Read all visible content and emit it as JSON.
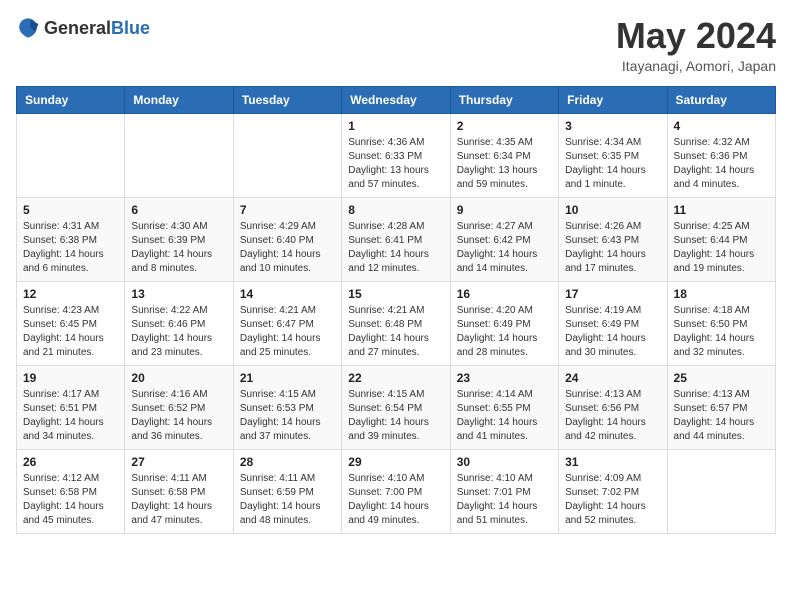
{
  "header": {
    "logo_general": "General",
    "logo_blue": "Blue",
    "month_title": "May 2024",
    "location": "Itayanagi, Aomori, Japan"
  },
  "days_of_week": [
    "Sunday",
    "Monday",
    "Tuesday",
    "Wednesday",
    "Thursday",
    "Friday",
    "Saturday"
  ],
  "weeks": [
    [
      {
        "day": "",
        "info": ""
      },
      {
        "day": "",
        "info": ""
      },
      {
        "day": "",
        "info": ""
      },
      {
        "day": "1",
        "info": "Sunrise: 4:36 AM\nSunset: 6:33 PM\nDaylight: 13 hours and 57 minutes."
      },
      {
        "day": "2",
        "info": "Sunrise: 4:35 AM\nSunset: 6:34 PM\nDaylight: 13 hours and 59 minutes."
      },
      {
        "day": "3",
        "info": "Sunrise: 4:34 AM\nSunset: 6:35 PM\nDaylight: 14 hours and 1 minute."
      },
      {
        "day": "4",
        "info": "Sunrise: 4:32 AM\nSunset: 6:36 PM\nDaylight: 14 hours and 4 minutes."
      }
    ],
    [
      {
        "day": "5",
        "info": "Sunrise: 4:31 AM\nSunset: 6:38 PM\nDaylight: 14 hours and 6 minutes."
      },
      {
        "day": "6",
        "info": "Sunrise: 4:30 AM\nSunset: 6:39 PM\nDaylight: 14 hours and 8 minutes."
      },
      {
        "day": "7",
        "info": "Sunrise: 4:29 AM\nSunset: 6:40 PM\nDaylight: 14 hours and 10 minutes."
      },
      {
        "day": "8",
        "info": "Sunrise: 4:28 AM\nSunset: 6:41 PM\nDaylight: 14 hours and 12 minutes."
      },
      {
        "day": "9",
        "info": "Sunrise: 4:27 AM\nSunset: 6:42 PM\nDaylight: 14 hours and 14 minutes."
      },
      {
        "day": "10",
        "info": "Sunrise: 4:26 AM\nSunset: 6:43 PM\nDaylight: 14 hours and 17 minutes."
      },
      {
        "day": "11",
        "info": "Sunrise: 4:25 AM\nSunset: 6:44 PM\nDaylight: 14 hours and 19 minutes."
      }
    ],
    [
      {
        "day": "12",
        "info": "Sunrise: 4:23 AM\nSunset: 6:45 PM\nDaylight: 14 hours and 21 minutes."
      },
      {
        "day": "13",
        "info": "Sunrise: 4:22 AM\nSunset: 6:46 PM\nDaylight: 14 hours and 23 minutes."
      },
      {
        "day": "14",
        "info": "Sunrise: 4:21 AM\nSunset: 6:47 PM\nDaylight: 14 hours and 25 minutes."
      },
      {
        "day": "15",
        "info": "Sunrise: 4:21 AM\nSunset: 6:48 PM\nDaylight: 14 hours and 27 minutes."
      },
      {
        "day": "16",
        "info": "Sunrise: 4:20 AM\nSunset: 6:49 PM\nDaylight: 14 hours and 28 minutes."
      },
      {
        "day": "17",
        "info": "Sunrise: 4:19 AM\nSunset: 6:49 PM\nDaylight: 14 hours and 30 minutes."
      },
      {
        "day": "18",
        "info": "Sunrise: 4:18 AM\nSunset: 6:50 PM\nDaylight: 14 hours and 32 minutes."
      }
    ],
    [
      {
        "day": "19",
        "info": "Sunrise: 4:17 AM\nSunset: 6:51 PM\nDaylight: 14 hours and 34 minutes."
      },
      {
        "day": "20",
        "info": "Sunrise: 4:16 AM\nSunset: 6:52 PM\nDaylight: 14 hours and 36 minutes."
      },
      {
        "day": "21",
        "info": "Sunrise: 4:15 AM\nSunset: 6:53 PM\nDaylight: 14 hours and 37 minutes."
      },
      {
        "day": "22",
        "info": "Sunrise: 4:15 AM\nSunset: 6:54 PM\nDaylight: 14 hours and 39 minutes."
      },
      {
        "day": "23",
        "info": "Sunrise: 4:14 AM\nSunset: 6:55 PM\nDaylight: 14 hours and 41 minutes."
      },
      {
        "day": "24",
        "info": "Sunrise: 4:13 AM\nSunset: 6:56 PM\nDaylight: 14 hours and 42 minutes."
      },
      {
        "day": "25",
        "info": "Sunrise: 4:13 AM\nSunset: 6:57 PM\nDaylight: 14 hours and 44 minutes."
      }
    ],
    [
      {
        "day": "26",
        "info": "Sunrise: 4:12 AM\nSunset: 6:58 PM\nDaylight: 14 hours and 45 minutes."
      },
      {
        "day": "27",
        "info": "Sunrise: 4:11 AM\nSunset: 6:58 PM\nDaylight: 14 hours and 47 minutes."
      },
      {
        "day": "28",
        "info": "Sunrise: 4:11 AM\nSunset: 6:59 PM\nDaylight: 14 hours and 48 minutes."
      },
      {
        "day": "29",
        "info": "Sunrise: 4:10 AM\nSunset: 7:00 PM\nDaylight: 14 hours and 49 minutes."
      },
      {
        "day": "30",
        "info": "Sunrise: 4:10 AM\nSunset: 7:01 PM\nDaylight: 14 hours and 51 minutes."
      },
      {
        "day": "31",
        "info": "Sunrise: 4:09 AM\nSunset: 7:02 PM\nDaylight: 14 hours and 52 minutes."
      },
      {
        "day": "",
        "info": ""
      }
    ]
  ]
}
